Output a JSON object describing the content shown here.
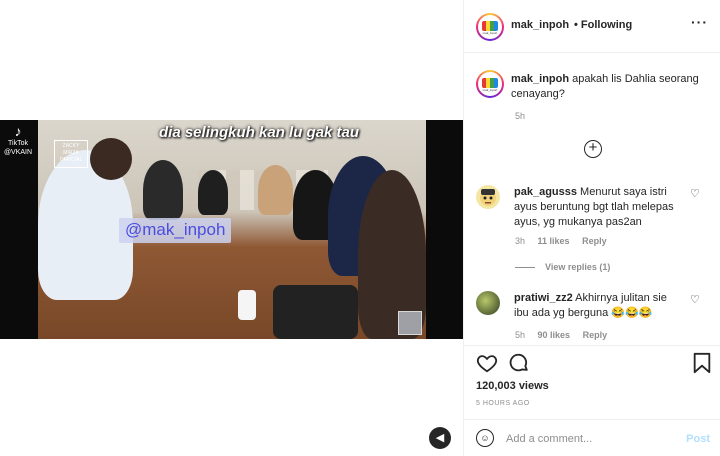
{
  "video": {
    "tiktok_label": "TikTok",
    "tiktok_handle": "@VKAIN",
    "caption_text": "dia selingkuh kan lu gak tau",
    "watermark_text": "ZACKY MIRZA OFFICIAL",
    "overlay_handle": "@mak_inpoh",
    "sound_icon": "speaker-muted-icon"
  },
  "post": {
    "author": "mak_inpoh",
    "follow_state": "• Following",
    "more_icon": "ellipsis-icon",
    "caption_author": "mak_inpoh",
    "caption_text": "apakah lis Dahlia seorang cenayang?",
    "caption_time": "5h",
    "load_more_icon": "plus-circle-icon"
  },
  "comments": [
    {
      "author": "pak_agusss",
      "text": "Menurut saya istri ayus beruntung bgt tlah melepas ayus, yg mukanya pas2an",
      "time": "3h",
      "likes": "11 likes",
      "reply": "Reply",
      "view_replies": "View replies (1)"
    },
    {
      "author": "pratiwi_zz2",
      "text": "Akhirnya julitan sie ibu ada yg berguna",
      "emojis": "😂😂😂",
      "time": "5h",
      "likes": "90 likes",
      "reply": "Reply"
    }
  ],
  "stats": {
    "views": "120,003 views",
    "posted": "5 HOURS AGO"
  },
  "composer": {
    "placeholder": "Add a comment...",
    "post_label": "Post"
  },
  "colors": {
    "link_disabled": "#b2dffc",
    "muted": "#8e8e8e",
    "text": "#262626"
  }
}
